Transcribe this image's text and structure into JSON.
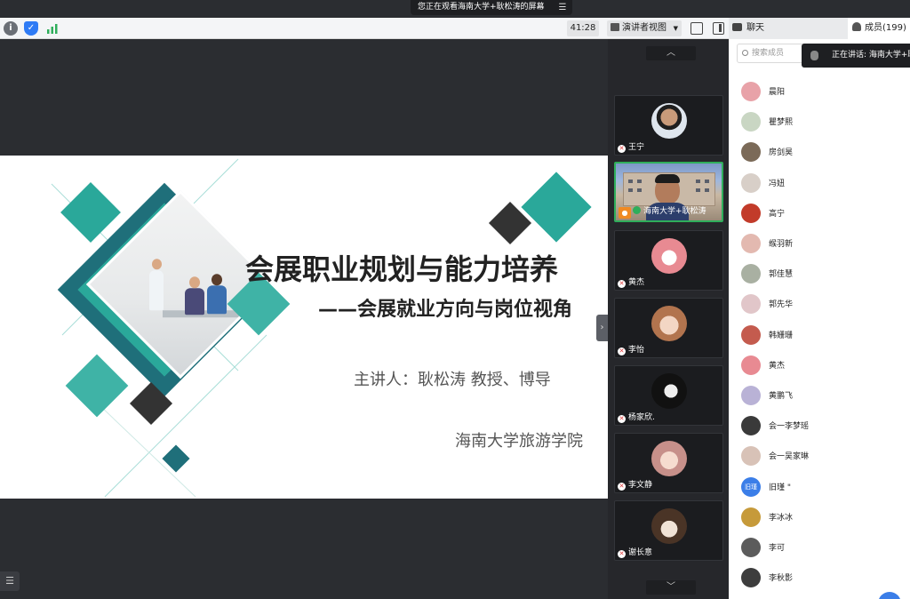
{
  "banner": {
    "text": "您正在观看海南大学+耿松涛的屏幕",
    "icon": "menu-icon"
  },
  "toolbar": {
    "timer": "41:28",
    "presenter_view": "演讲者视图",
    "chat_tab": "聊天",
    "members_tab": "成员(199)",
    "status_colors": {
      "info": "#6b6f76",
      "shield": "#2f7bf5",
      "signal": "#2fae5b"
    }
  },
  "slide": {
    "title": "会展职业规划与能力培养",
    "subtitle": "——会展就业方向与岗位视角",
    "speaker": "主讲人：耿松涛  教授、博导",
    "school": "海南大学旅游学院",
    "accent_teal": "#2aa89a",
    "accent_dark": "#333333"
  },
  "video_tiles": [
    {
      "name": "王宁",
      "mic": "off",
      "active": false
    },
    {
      "name": "海南大学+耿松涛",
      "mic": "on",
      "active": true,
      "host": true
    },
    {
      "name": "黄杰",
      "mic": "off",
      "active": false
    },
    {
      "name": "李怡",
      "mic": "off",
      "active": false
    },
    {
      "name": "杨家欣.",
      "mic": "off",
      "active": false
    },
    {
      "name": "李文静",
      "mic": "off",
      "active": false
    },
    {
      "name": "谢长意",
      "mic": "off",
      "active": false
    }
  ],
  "members_panel": {
    "search_placeholder": "搜索成员",
    "speaking_text": "正在讲话: 海南大学+耿松涛",
    "list": [
      {
        "name": "晨阳",
        "color": "#e8a2a8"
      },
      {
        "name": "瞿梦熙",
        "color": "#c9d6c3"
      },
      {
        "name": "房剑昊",
        "color": "#7b6a58"
      },
      {
        "name": "冯妞",
        "color": "#d8cfc8"
      },
      {
        "name": "高宁",
        "color": "#c23b2a"
      },
      {
        "name": "缑羽新",
        "color": "#e3b9b0"
      },
      {
        "name": "郭佳慧",
        "color": "#a9b0a2"
      },
      {
        "name": "郭先华",
        "color": "#e1c6c9"
      },
      {
        "name": "韩姗珊",
        "color": "#c45b4e"
      },
      {
        "name": "黄杰",
        "color": "#e88a92"
      },
      {
        "name": "黄鹏飞",
        "color": "#b9b2d6"
      },
      {
        "name": "会一李梦瑶",
        "color": "#3a3a3a"
      },
      {
        "name": "会一吴家琳",
        "color": "#d8c2b7"
      },
      {
        "name": "旧瑾 \"",
        "color": "#3b7ee8",
        "avatar_text": "旧瑾"
      },
      {
        "name": "李冰冰",
        "color": "#c69a3a"
      },
      {
        "name": "李可",
        "color": "#5c5c5c"
      },
      {
        "name": "李秋影",
        "color": "#3d3d3d"
      }
    ]
  }
}
